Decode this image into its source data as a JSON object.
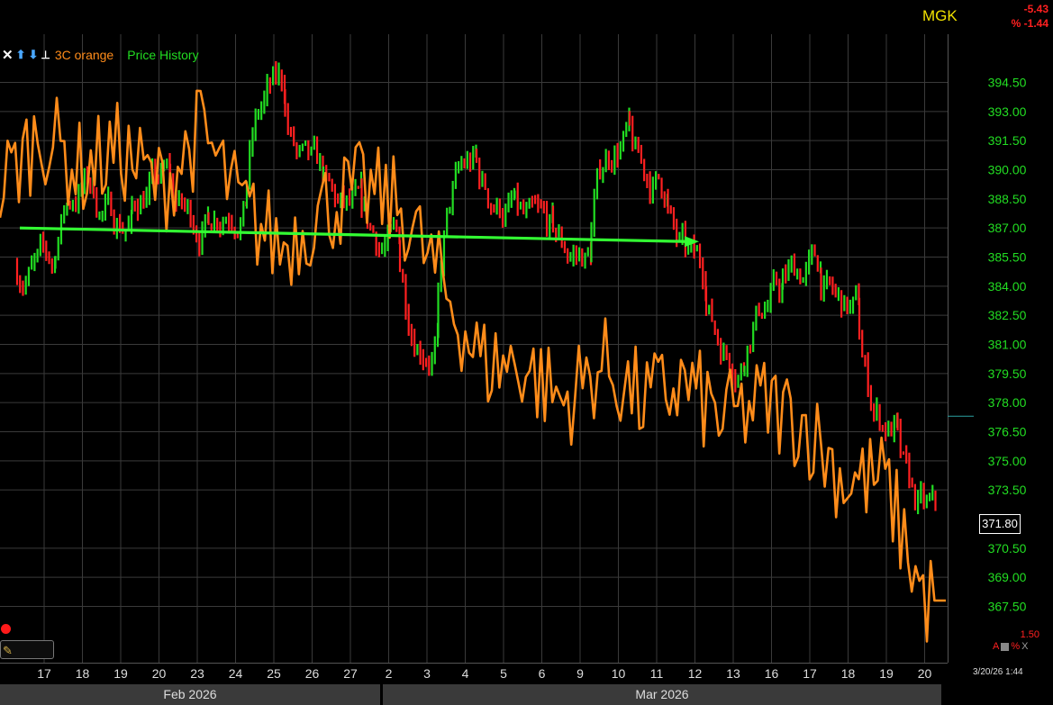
{
  "header": {
    "ticker": "MGK",
    "change_abs": "-5.43",
    "change_pct": "% -1.44"
  },
  "legend": {
    "icons": [
      "close-icon",
      "arrow-up-icon",
      "arrow-down-icon",
      "pin-icon"
    ],
    "indicator_label": "3C orange",
    "price_label": "Price History"
  },
  "colors": {
    "background": "#000000",
    "grid": "#3a3a3a",
    "up_bar": "#22dd22",
    "down_bar": "#ff2020",
    "indicator": "#ff8c1a",
    "trend_arrow": "#33ff33",
    "price_axis_text": "#22dd22",
    "ticker": "#f0e000"
  },
  "last_price_label": "371.80",
  "indicator_value_label": "1.50",
  "indicator_controls": [
    "A",
    "%",
    "X"
  ],
  "date_stamp": "3/20/26 1:44",
  "months": [
    "Feb 2026",
    "Mar 2026"
  ],
  "chart_data": {
    "type": "line",
    "title": "",
    "ticker": "MGK",
    "y_axis": {
      "ticks": [
        "394.50",
        "393.00",
        "391.50",
        "390.00",
        "388.50",
        "387.00",
        "385.50",
        "384.00",
        "382.50",
        "381.00",
        "379.50",
        "378.00",
        "376.50",
        "375.00",
        "373.50",
        "370.50",
        "369.00",
        "367.50"
      ],
      "tick_values": [
        394.5,
        393.0,
        391.5,
        390.0,
        388.5,
        387.0,
        385.5,
        384.0,
        382.5,
        381.0,
        379.5,
        378.0,
        376.5,
        375.0,
        373.5,
        370.5,
        369.0,
        367.5
      ],
      "range": [
        366.5,
        396.5
      ],
      "last_price": 371.8
    },
    "x_axis": {
      "categories": [
        "17",
        "18",
        "19",
        "20",
        "23",
        "24",
        "25",
        "26",
        "27",
        "2",
        "3",
        "4",
        "5",
        "6",
        "9",
        "10",
        "11",
        "12",
        "13",
        "16",
        "17",
        "18",
        "19",
        "20"
      ],
      "months": [
        "Feb 2026",
        "Mar 2026"
      ]
    },
    "grid": true,
    "series": [
      {
        "name": "Price History",
        "type": "intraday bars",
        "approx_daily_close": [
          385.0,
          389.5,
          387.3,
          389.5,
          387.2,
          388.6,
          394.4,
          389.2,
          387.4,
          386.0,
          381.0,
          390.5,
          388.0,
          386.5,
          385.5,
          392.0,
          389.0,
          384.5,
          380.3,
          383.8,
          385.0,
          382.5,
          376.5,
          371.8
        ],
        "trend_arrow": {
          "from": {
            "date": "Feb 17",
            "price": 387.0
          },
          "to": {
            "date": "Mar 12",
            "price": 386.3
          }
        }
      },
      {
        "name": "3C orange",
        "type": "line",
        "approx_daily_values": [
          389,
          392,
          390,
          391,
          389,
          392,
          388,
          386,
          388,
          389,
          388,
          384,
          380,
          380,
          378,
          380,
          378,
          379,
          377,
          378,
          377,
          374,
          374,
          367.8
        ]
      }
    ]
  }
}
